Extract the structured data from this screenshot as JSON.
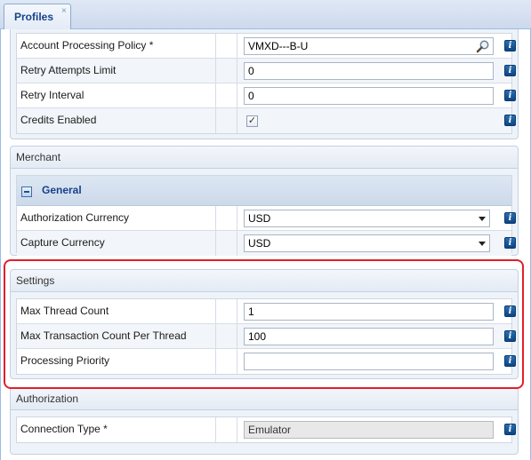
{
  "tab": {
    "label": "Profiles",
    "close_glyph": "×"
  },
  "top_panel": {
    "rows": [
      {
        "label": "Account Processing Policy *",
        "value": "VMXD---B-U"
      },
      {
        "label": "Retry Attempts Limit",
        "value": "0"
      },
      {
        "label": "Retry Interval",
        "value": "0"
      },
      {
        "label": "Credits Enabled",
        "checked": true
      }
    ]
  },
  "merchant": {
    "title": "Merchant",
    "section": "General",
    "rows": [
      {
        "label": "Authorization Currency",
        "value": "USD"
      },
      {
        "label": "Capture Currency",
        "value": "USD"
      }
    ]
  },
  "settings": {
    "title": "Settings",
    "rows": [
      {
        "label": "Max Thread Count",
        "value": "1"
      },
      {
        "label": "Max Transaction Count Per Thread",
        "value": "100"
      },
      {
        "label": "Processing Priority",
        "value": ""
      }
    ]
  },
  "authorization": {
    "title": "Authorization",
    "rows": [
      {
        "label": "Connection Type *",
        "value": "Emulator"
      }
    ]
  },
  "info_glyph": "i",
  "check_glyph": "✓",
  "colors": {
    "highlight": "#e0202a",
    "accent": "#15428b"
  }
}
